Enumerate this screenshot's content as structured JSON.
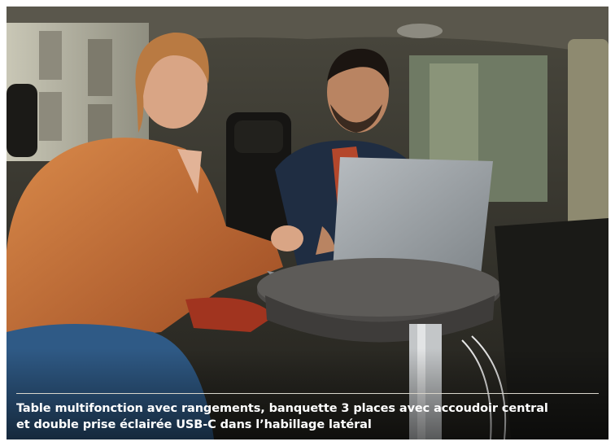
{
  "photo": {
    "subject": "woman-and-man-with-laptop-at-round-table-in-van",
    "colors": {
      "cabin": "#3a382f",
      "window": "#cfd0c4",
      "jacket": "#c8682f",
      "skirt": "#2f5a86",
      "suit": "#1f2d42",
      "laptop": "#9fa4a8",
      "table": "#4c4a48"
    }
  },
  "caption": {
    "line1": "Table multifonction avec rangements, banquette 3 places avec accoudoir central",
    "line2": "et double prise éclairée USB-C dans l’habillage latéral"
  }
}
